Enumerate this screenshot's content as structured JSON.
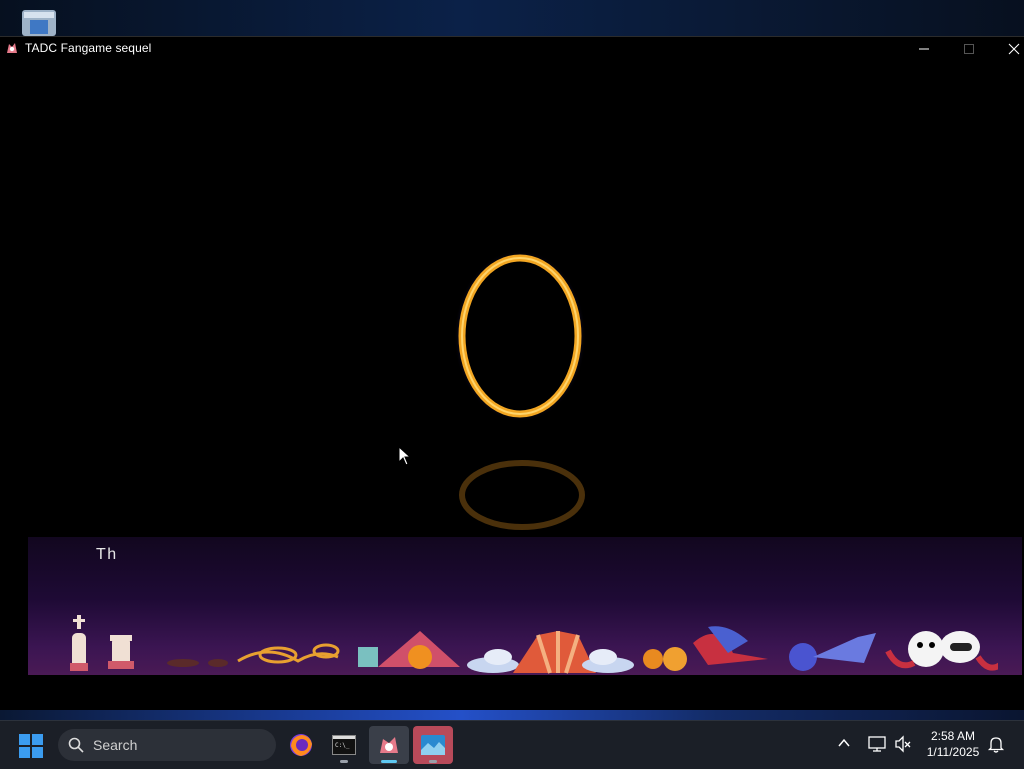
{
  "window": {
    "title": "TADC Fangame sequel"
  },
  "game": {
    "dialog_text": "Th",
    "portal_color": "#f0a020"
  },
  "taskbar": {
    "search_label": "Search",
    "apps": [
      {
        "name": "Firefox",
        "icon": "firefox-icon"
      },
      {
        "name": "Terminal",
        "icon": "terminal-icon"
      },
      {
        "name": "TADC Fangame sequel",
        "icon": "game-icon",
        "focused": true
      },
      {
        "name": "Image viewer",
        "icon": "image-app-icon",
        "running": true
      }
    ],
    "time": "2:58 AM",
    "date": "1/11/2025"
  }
}
